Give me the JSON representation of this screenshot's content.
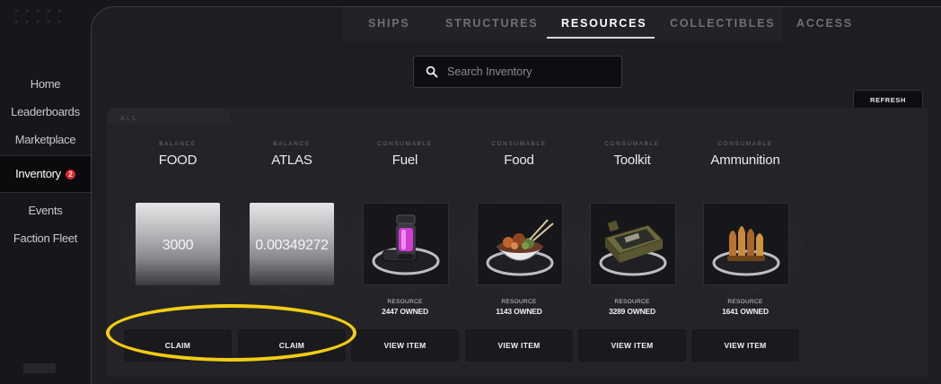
{
  "sidebar": {
    "items": [
      {
        "label": "Home"
      },
      {
        "label": "Leaderboards"
      },
      {
        "label": "Marketplace"
      },
      {
        "label": "Inventory",
        "badge": "2",
        "active": true
      },
      {
        "label": "Events"
      },
      {
        "label": "Faction Fleet"
      }
    ]
  },
  "tabs": [
    {
      "label": "SHIPS"
    },
    {
      "label": "STRUCTURES"
    },
    {
      "label": "RESOURCES",
      "active": true
    },
    {
      "label": "COLLECTIBLES"
    },
    {
      "label": "ACCESS"
    }
  ],
  "search": {
    "placeholder": "Search Inventory"
  },
  "refresh_label": "REFRESH",
  "filter_label": "ALL",
  "items": [
    {
      "category": "BALANCE",
      "name": "FOOD",
      "value": "3000",
      "action": "CLAIM"
    },
    {
      "category": "BALANCE",
      "name": "ATLAS",
      "value": "0.00349272",
      "action": "CLAIM"
    },
    {
      "category": "CONSUMABLE",
      "name": "Fuel",
      "type": "RESOURCE",
      "owned": "2447 OWNED",
      "action": "VIEW ITEM",
      "icon": "fuel-canister-icon"
    },
    {
      "category": "CONSUMABLE",
      "name": "Food",
      "type": "RESOURCE",
      "owned": "1143 OWNED",
      "action": "VIEW ITEM",
      "icon": "food-bowl-icon"
    },
    {
      "category": "CONSUMABLE",
      "name": "Toolkit",
      "type": "RESOURCE",
      "owned": "3289 OWNED",
      "action": "VIEW ITEM",
      "icon": "toolkit-case-icon"
    },
    {
      "category": "CONSUMABLE",
      "name": "Ammunition",
      "type": "RESOURCE",
      "owned": "1641 OWNED",
      "action": "VIEW ITEM",
      "icon": "ammunition-icon"
    }
  ],
  "colors": {
    "background": "#16161b",
    "panel": "#1d1d22",
    "highlight": "#f2cc14",
    "badge": "#e0242f",
    "fuel_accent": "#d23bd4"
  }
}
